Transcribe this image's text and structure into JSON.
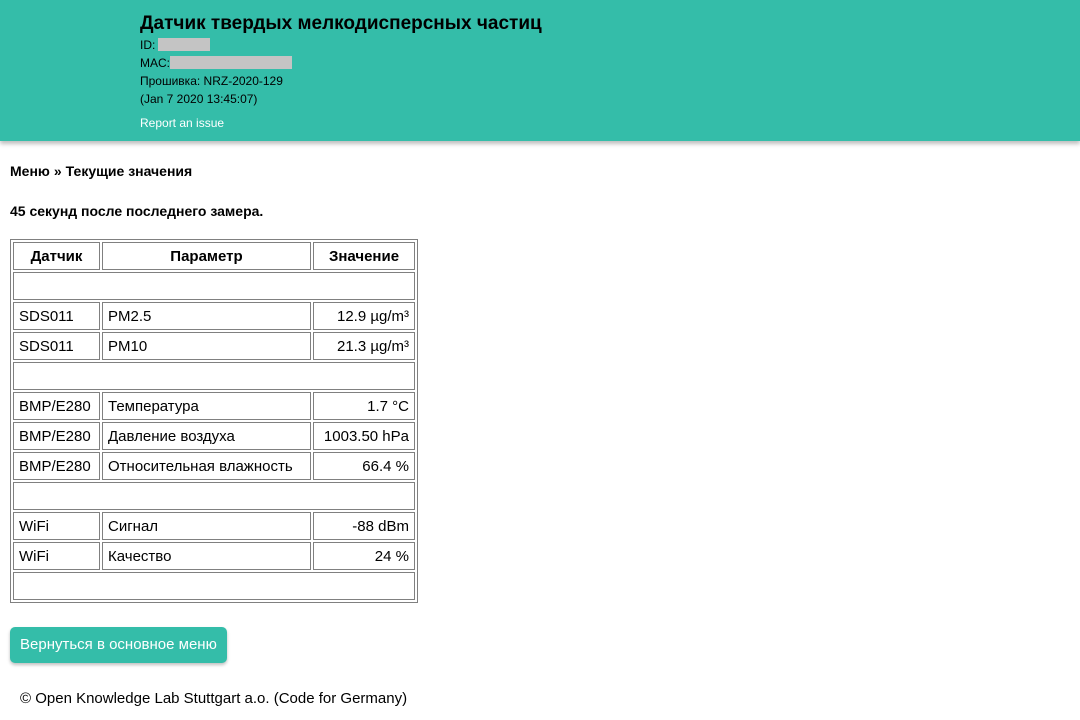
{
  "header": {
    "title": "Датчик твердых мелкодисперсных частиц",
    "id_label": "ID:",
    "mac_label": "MAC:",
    "firmware": "Прошивка: NRZ-2020-129",
    "build_date": "(Jan 7 2020 13:45:07)",
    "report_link": "Report an issue",
    "accent_color": "#34bda9"
  },
  "breadcrumb": {
    "menu": "Меню",
    "separator": "»",
    "current": "Текущие значения"
  },
  "since_text": "45 секунд после последнего замера.",
  "table": {
    "headers": [
      "Датчик",
      "Параметр",
      "Значение"
    ],
    "rows": [
      {
        "sensor": "SDS011",
        "param": "PM2.5",
        "value": "12.9 µg/m³"
      },
      {
        "sensor": "SDS011",
        "param": "PM10",
        "value": "21.3 µg/m³"
      },
      {
        "sensor": "BMP/E280",
        "param": "Температура",
        "value": "1.7 °C"
      },
      {
        "sensor": "BMP/E280",
        "param": "Давление воздуха",
        "value": "1003.50 hPa"
      },
      {
        "sensor": "BMP/E280",
        "param": "Относительная влажность",
        "value": "66.4 %"
      },
      {
        "sensor": "WiFi",
        "param": "Сигнал",
        "value": "-88 dBm"
      },
      {
        "sensor": "WiFi",
        "param": "Качество",
        "value": "24 %"
      }
    ]
  },
  "back_button": "Вернуться в основное меню",
  "footer": "© Open Knowledge Lab Stuttgart a.o. (Code for Germany)"
}
